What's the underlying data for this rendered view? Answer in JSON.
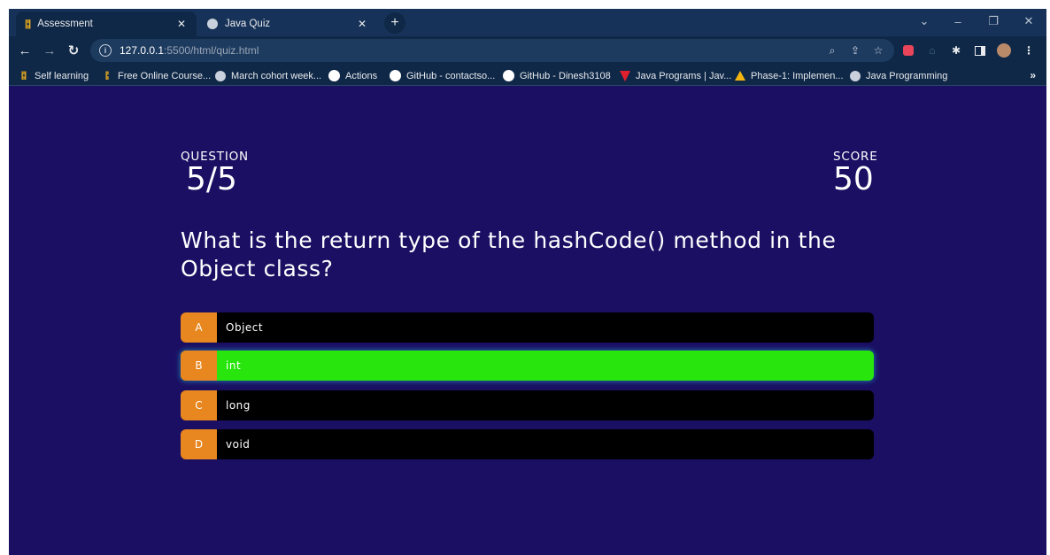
{
  "browser": {
    "tabs": [
      {
        "title": "Assessment",
        "icon": "assessment-favicon",
        "active": true
      },
      {
        "title": "Java Quiz",
        "icon": "globe-icon",
        "active": false
      }
    ],
    "new_tab_symbol": "+",
    "window_controls": {
      "chevron": "⌄",
      "minimize": "–",
      "restore": "❐",
      "close": "✕"
    },
    "address": {
      "host": "127.0.0.1",
      "rest": ":5500/html/quiz.html"
    },
    "bookmarks": [
      {
        "label": "Self learning",
        "icon": "assessment-favicon"
      },
      {
        "label": "Free Online Course...",
        "icon": "assessment-favicon"
      },
      {
        "label": "March cohort week...",
        "icon": "globe-icon"
      },
      {
        "label": "Actions",
        "icon": "github-icon"
      },
      {
        "label": "GitHub - contactso...",
        "icon": "github-icon"
      },
      {
        "label": "GitHub - Dinesh3108",
        "icon": "github-icon"
      },
      {
        "label": "Java Programs | Jav...",
        "icon": "red-v-icon"
      },
      {
        "label": "Phase-1: Implemen...",
        "icon": "google-drive-icon"
      },
      {
        "label": "Java Programming",
        "icon": "globe-icon"
      }
    ],
    "bookmarks_more": "»"
  },
  "quiz": {
    "question_label": "QUESTION",
    "question_progress": "5/5",
    "score_label": "SCORE",
    "score_value": "50",
    "question_text": "What is the return type of the hashCode() method in the Object class?",
    "choices": [
      {
        "prefix": "A",
        "text": "Object",
        "state": "default"
      },
      {
        "prefix": "B",
        "text": "int",
        "state": "correct"
      },
      {
        "prefix": "C",
        "text": "long",
        "state": "default"
      },
      {
        "prefix": "D",
        "text": "void",
        "state": "default"
      }
    ]
  },
  "colors": {
    "page_bg": "#1b0f63",
    "prefix_bg": "#e8861f",
    "correct_bg": "#28e60d",
    "choice_bg": "#000000"
  }
}
